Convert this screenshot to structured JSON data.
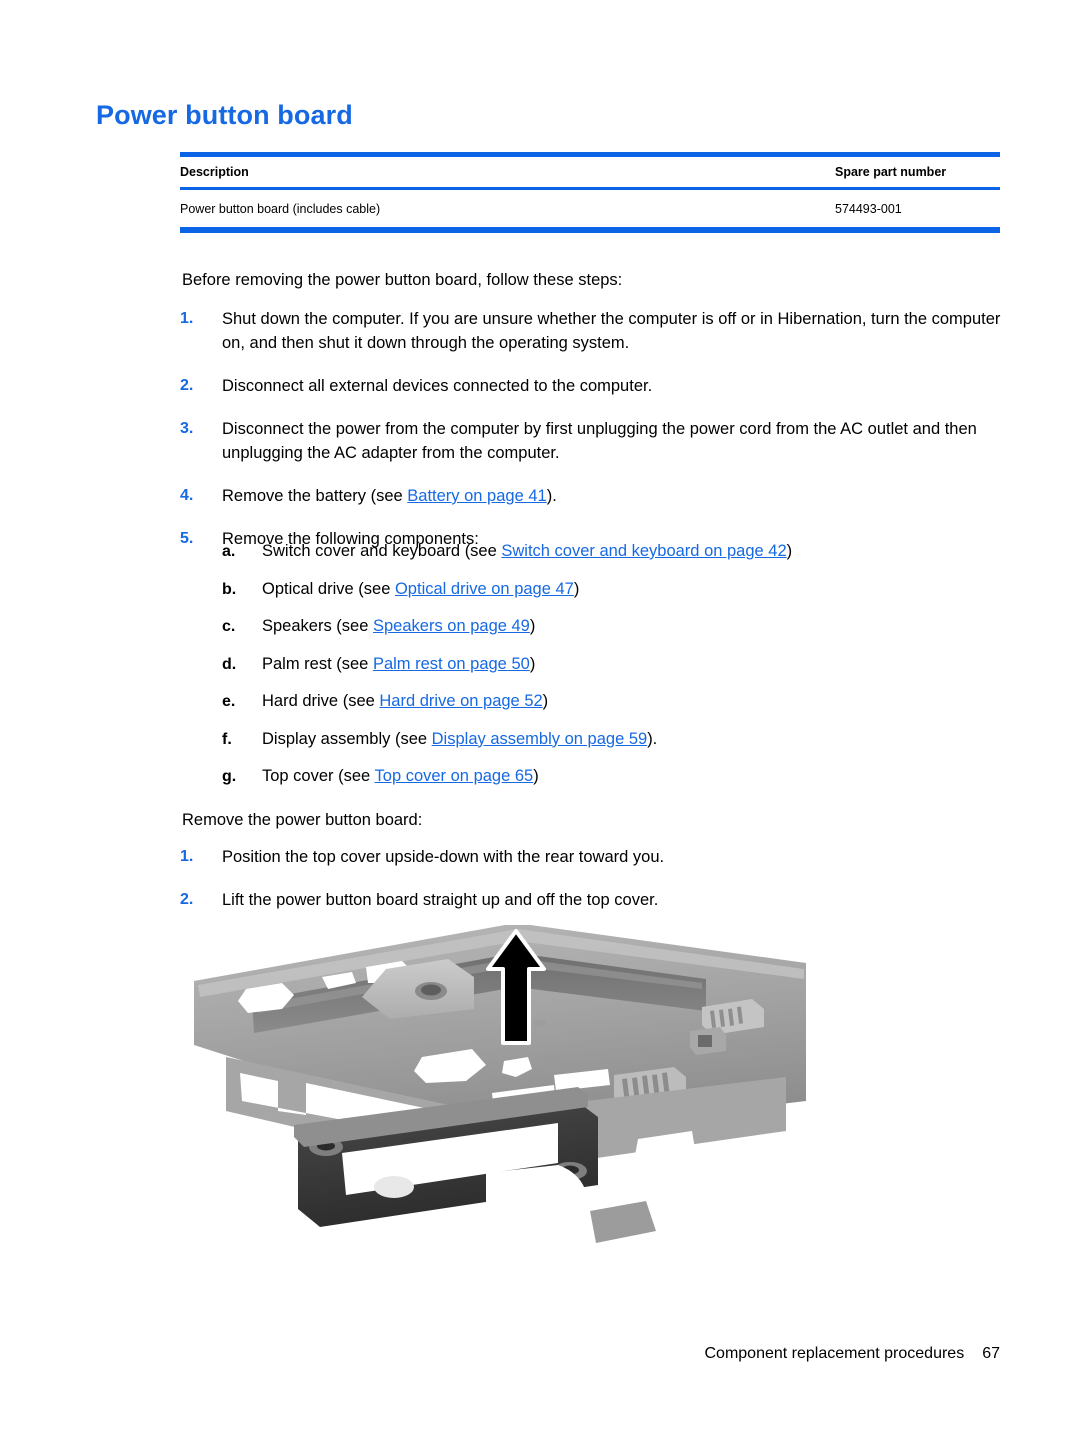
{
  "heading": "Power button board",
  "parts_table": {
    "columns": [
      "Description",
      "Spare part number"
    ],
    "rows": [
      {
        "description": "Power button board (includes cable)",
        "spare_part_number": "574493-001"
      }
    ]
  },
  "intro": "Before removing the power button board, follow these steps:",
  "prep_steps": [
    {
      "marker": "1.",
      "text": "Shut down the computer. If you are unsure whether the computer is off or in Hibernation, turn the computer on, and then shut it down through the operating system."
    },
    {
      "marker": "2.",
      "text": "Disconnect all external devices connected to the computer."
    },
    {
      "marker": "3.",
      "text": "Disconnect the power from the computer by first unplugging the power cord from the AC outlet and then unplugging the AC adapter from the computer."
    },
    {
      "marker": "4.",
      "prefix": "Remove the battery (see ",
      "link": "Battery on page 41",
      "suffix": ")."
    },
    {
      "marker": "5.",
      "text": "Remove the following components:"
    }
  ],
  "components": [
    {
      "marker": "a.",
      "prefix": "Switch cover and keyboard (see ",
      "link": "Switch cover and keyboard on page 42",
      "suffix": ")"
    },
    {
      "marker": "b.",
      "prefix": "Optical drive (see ",
      "link": "Optical drive on page 47",
      "suffix": ")"
    },
    {
      "marker": "c.",
      "prefix": "Speakers (see ",
      "link": "Speakers on page 49",
      "suffix": ")"
    },
    {
      "marker": "d.",
      "prefix": "Palm rest (see ",
      "link": "Palm rest on page 50",
      "suffix": ")"
    },
    {
      "marker": "e.",
      "prefix": "Hard drive (see ",
      "link": "Hard drive on page 52",
      "suffix": ")"
    },
    {
      "marker": "f.",
      "prefix": "Display assembly (see ",
      "link": "Display assembly on page 59",
      "suffix": ")."
    },
    {
      "marker": "g.",
      "prefix": "Top cover (see ",
      "link": "Top cover on page 65",
      "suffix": ")"
    }
  ],
  "remove_lead": "Remove the power button board:",
  "remove_steps": [
    {
      "marker": "1.",
      "text": "Position the top cover upside-down with the rear toward you."
    },
    {
      "marker": "2.",
      "text": "Lift the power button board straight up and off the top cover."
    }
  ],
  "figure": {
    "caption_icon": "up-arrow-icon",
    "description": "Top cover shown upside-down with power button board being lifted straight up"
  },
  "footer": {
    "label": "Component replacement procedures",
    "page_number": "67"
  },
  "colors": {
    "heading_blue": "#1669e3",
    "rule_blue": "#0b63e5",
    "link_blue": "#1669e3",
    "text_black": "#000000"
  }
}
